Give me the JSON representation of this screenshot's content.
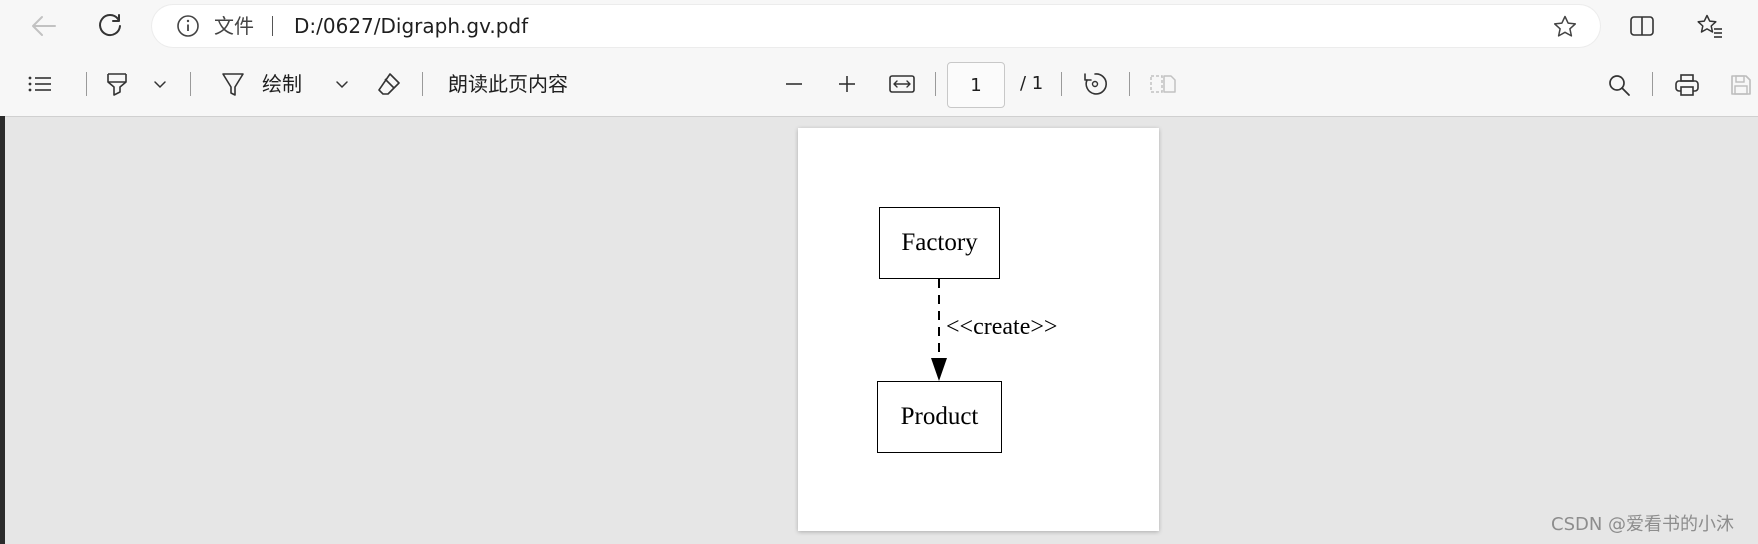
{
  "browser": {
    "address_bar": {
      "scheme_label": "文件",
      "url": "D:/0627/Digraph.gv.pdf"
    },
    "icons": {
      "back": "back-arrow-icon",
      "refresh": "refresh-icon",
      "info": "info-icon",
      "favorite": "star-icon",
      "split_screen": "split-screen-icon",
      "favorites": "favorites-list-icon"
    }
  },
  "pdf_toolbar": {
    "draw_label": "绘制",
    "read_aloud_label": "朗读此页内容",
    "page": {
      "current": "1",
      "total_label": "/ 1"
    },
    "icons": {
      "contents": "table-of-contents-icon",
      "highlight": "highlighter-icon",
      "draw": "draw-pen-icon",
      "erase": "eraser-icon",
      "zoom_out": "minus-icon",
      "zoom_in": "plus-icon",
      "fit": "fit-to-width-icon",
      "rotate": "rotate-icon",
      "page_view": "page-view-icon",
      "search": "search-icon",
      "print": "print-icon",
      "save": "save-icon"
    }
  },
  "document": {
    "nodes": {
      "factory": "Factory",
      "product": "Product"
    },
    "edge_label": "<<create>>"
  },
  "watermark": "CSDN @爱看书的小沐"
}
